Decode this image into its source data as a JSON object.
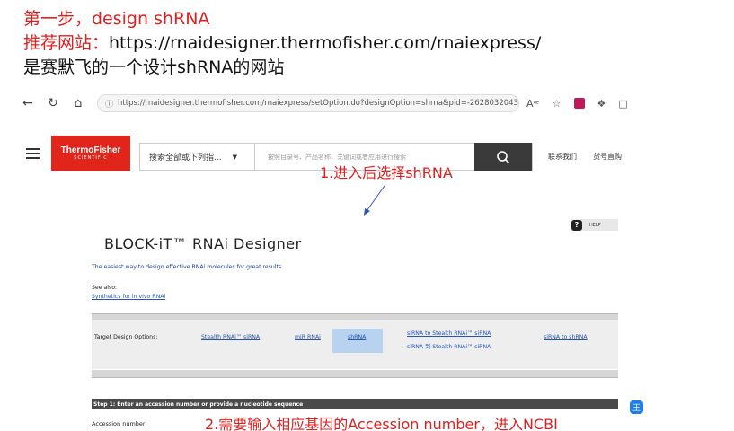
{
  "slide": {
    "title": "第一步，design shRNA",
    "site_label": "推荐网站：",
    "site_url": "https://rnaidesigner.thermofisher.com/rnaiexpress/",
    "description": "是赛默飞的一个设计shRNA的网站"
  },
  "browser": {
    "address": "https://rnaidesigner.thermofisher.com/rnaiexpress/setOption.do?designOption=shrna&pid=-262803204330..."
  },
  "header": {
    "logo_line1": "ThermoFisher",
    "logo_line2": "SCIENTIFIC",
    "search_category": "搜索全部或下列指...",
    "search_placeholder": "按照目录号、产品名称、关键词或者应用进行搜索",
    "link_contact": "联系我们",
    "link_order": "货号直购"
  },
  "designer": {
    "help_label": "HELP",
    "title": "BLOCK-iT™ RNAi Designer",
    "tagline": "The easiest way to design effective RNAi molecules for great results",
    "see_also": "See also:",
    "see_also_link": "Synthetics for in vivo RNAi",
    "target_label": "Target Design Options:",
    "options": {
      "stealth": "Stealth RNAi™ siRNA",
      "mirna": "miR RNAi",
      "shrna": "shRNA",
      "sirna_to_stealth": "siRNA to Stealth RNAi™ siRNA",
      "sirna_to_stealth_cn": "siRNA 到 Stealth RNAi™ siRNA",
      "sirna_to_shrna": "siRNA to shRNA"
    },
    "step1": "Step 1: Enter an accession number or provide a nucleotide sequence",
    "accession_label": "Accession number:"
  },
  "annotations": {
    "note1": "1.进入后选择shRNA",
    "note2": "2.需要输入相应基因的Accession number，进入NCBI"
  },
  "colors": {
    "annotation_red": "#e02020",
    "brand_red": "#e1251b",
    "selected_option": "#b8d3ef",
    "link_blue": "#2255bb"
  }
}
